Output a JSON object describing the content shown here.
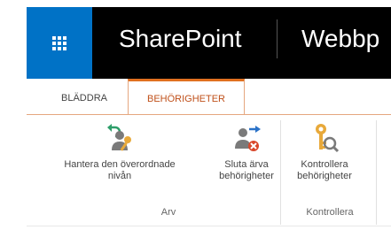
{
  "suitebar": {
    "brand": "SharePoint",
    "site_title": "Webbp"
  },
  "tabs": [
    {
      "label": "BLÄDDRA"
    },
    {
      "label": "BEHÖRIGHETER"
    }
  ],
  "ribbon": {
    "buttons": [
      {
        "label_line1": "Hantera den överordnade",
        "label_line2": "nivån",
        "icon": "manage-parent-icon"
      },
      {
        "label_line1": "Sluta ärva",
        "label_line2": "behörigheter",
        "icon": "stop-inheriting-icon"
      },
      {
        "label_line1": "Kontrollera",
        "label_line2": "behörigheter",
        "icon": "check-permissions-icon"
      }
    ],
    "groups": [
      {
        "label": "Arv"
      },
      {
        "label": "Kontrollera"
      }
    ]
  },
  "colors": {
    "suitebar": "#000000",
    "waffle": "#0072c6",
    "accent": "#e07020",
    "active_tab_text": "#c0501a"
  }
}
